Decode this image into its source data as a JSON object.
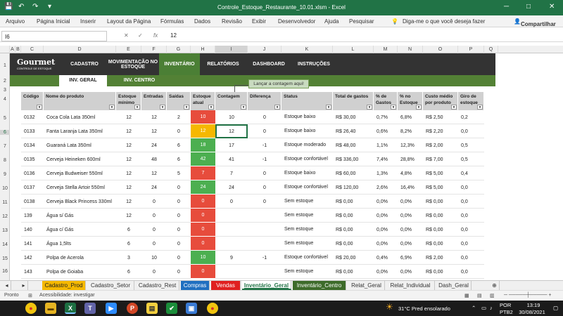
{
  "titlebar": {
    "title": "Controle_Estoque_Restaurante_10.01.xlsm  -  Excel"
  },
  "ribbon": {
    "tabs": [
      "Arquivo",
      "Página Inicial",
      "Inserir",
      "Layout da Página",
      "Fórmulas",
      "Dados",
      "Revisão",
      "Exibir",
      "Desenvolvedor",
      "Ajuda",
      "Pesquisar"
    ],
    "tell_me": "Diga-me o que você deseja fazer",
    "share": "Compartilhar"
  },
  "formula": {
    "name_box": "I6",
    "fx": "fx",
    "value": "12"
  },
  "columns": [
    "A",
    "B",
    "C",
    "D",
    "E",
    "F",
    "G",
    "H",
    "I",
    "J",
    "K",
    "L",
    "M",
    "N",
    "O",
    "P",
    "Q"
  ],
  "rows": [
    "1",
    "2",
    "3",
    "4",
    "5",
    "6",
    "7",
    "8",
    "9",
    "10",
    "11",
    "12",
    "13",
    "14",
    "15",
    "16"
  ],
  "nav": {
    "logo": "Gourmet",
    "logo_sub": "CONTROLE DE ESTOQUE",
    "items": [
      "CADASTRO",
      "MOVIMENTAÇÃO NO ESTOQUE",
      "INVENTÁRIO",
      "RELATÓRIOS",
      "DASHBOARD",
      "INSTRUÇÕES"
    ]
  },
  "subtabs": [
    "INV. GERAL",
    "INV. CENTRO"
  ],
  "callout": "Lançar a contagem aqui!",
  "table": {
    "headers": [
      "Código",
      "Nome do produto",
      "Estoque mínimo",
      "Entradas",
      "Saídas",
      "Estoque atual",
      "Contagem",
      "Diferença",
      "Status",
      "Total de gastos",
      "% de Gastos",
      "% no Estoque",
      "Custo médio por produto",
      "Giro de estoque"
    ],
    "rows": [
      [
        "0132",
        "Coca Cola Lata 350ml",
        "12",
        "12",
        "2",
        "10",
        "10",
        "0",
        "Estoque baixo",
        "R$ 30,00",
        "0,7%",
        "6,8%",
        "R$ 2,50",
        "0,2"
      ],
      [
        "0133",
        "Fanta Laranja Lata 350ml",
        "12",
        "12",
        "0",
        "12",
        "12",
        "0",
        "Estoque baixo",
        "R$ 26,40",
        "0,6%",
        "8,2%",
        "R$ 2,20",
        "0,0"
      ],
      [
        "0134",
        "Guaraná Lata 350ml",
        "12",
        "24",
        "6",
        "18",
        "17",
        "-1",
        "Estoque moderado",
        "R$ 48,00",
        "1,1%",
        "12,3%",
        "R$ 2,00",
        "0,5"
      ],
      [
        "0135",
        "Cerveja Heineken 600ml",
        "12",
        "48",
        "6",
        "42",
        "41",
        "-1",
        "Estoque confortável",
        "R$ 336,00",
        "7,4%",
        "28,8%",
        "R$ 7,00",
        "0,5"
      ],
      [
        "0136",
        "Cerveja Budweiser 550ml",
        "12",
        "12",
        "5",
        "7",
        "7",
        "0",
        "Estoque baixo",
        "R$ 60,00",
        "1,3%",
        "4,8%",
        "R$ 5,00",
        "0,4"
      ],
      [
        "0137",
        "Cerveja Stella Artoir 550ml",
        "12",
        "24",
        "0",
        "24",
        "24",
        "0",
        "Estoque confortável",
        "R$ 120,00",
        "2,6%",
        "16,4%",
        "R$ 5,00",
        "0,0"
      ],
      [
        "0138",
        "Cerveja Black Princess 330ml",
        "12",
        "0",
        "0",
        "0",
        "0",
        "0",
        "Sem estoque",
        "R$ 0,00",
        "0,0%",
        "0,0%",
        "R$ 0,00",
        "0,0"
      ],
      [
        "139",
        "Água s/ Gás",
        "12",
        "0",
        "0",
        "0",
        "",
        "",
        "Sem estoque",
        "R$ 0,00",
        "0,0%",
        "0,0%",
        "R$ 0,00",
        "0,0"
      ],
      [
        "140",
        "Água c/ Gás",
        "6",
        "0",
        "0",
        "0",
        "",
        "",
        "Sem estoque",
        "R$ 0,00",
        "0,0%",
        "0,0%",
        "R$ 0,00",
        "0,0"
      ],
      [
        "141",
        "Água 1,5lts",
        "6",
        "0",
        "0",
        "0",
        "",
        "",
        "Sem estoque",
        "R$ 0,00",
        "0,0%",
        "0,0%",
        "R$ 0,00",
        "0,0"
      ],
      [
        "142",
        "Polpa de Acerola",
        "3",
        "10",
        "0",
        "10",
        "9",
        "-1",
        "Estoque confortável",
        "R$ 20,00",
        "0,4%",
        "6,9%",
        "R$ 2,00",
        "0,0"
      ],
      [
        "143",
        "Polpa de Goiaba",
        "6",
        "0",
        "0",
        "0",
        "",
        "",
        "Sem estoque",
        "R$ 0,00",
        "0,0%",
        "0,0%",
        "R$ 0,00",
        "0,0"
      ]
    ],
    "atual_colors": [
      "red",
      "orange",
      "green",
      "green",
      "red",
      "green",
      "red",
      "red",
      "red",
      "red",
      "green",
      "red"
    ]
  },
  "colors": {
    "red": "#e74c3c",
    "orange": "#f5b800",
    "green": "#4caf50",
    "excel_green": "#217346"
  },
  "sheets": [
    {
      "name": "Cadastro_Prod",
      "bg": "#f5b800",
      "fg": "#222"
    },
    {
      "name": "Cadastro_Setor",
      "bg": "",
      "fg": "#333"
    },
    {
      "name": "Cadastro_Rest",
      "bg": "",
      "fg": "#333"
    },
    {
      "name": "Compras",
      "bg": "#1f6fc0",
      "fg": "#fff"
    },
    {
      "name": "Vendas",
      "bg": "#e02020",
      "fg": "#fff"
    },
    {
      "name": "Inventário_Geral",
      "bg": "#ffffff",
      "fg": "#217346"
    },
    {
      "name": "Inventário_Centro",
      "bg": "#3d6b2a",
      "fg": "#fff"
    },
    {
      "name": "Relat_Geral",
      "bg": "",
      "fg": "#333"
    },
    {
      "name": "Relat_Individual",
      "bg": "",
      "fg": "#333"
    },
    {
      "name": "Dash_Geral",
      "bg": "",
      "fg": "#333"
    }
  ],
  "status": {
    "ready": "Pronto",
    "accessibility": "Acessibilidade: investigar"
  },
  "taskbar": {
    "weather": "31°C  Pred ensolarado",
    "lang1": "POR",
    "lang2": "PTB2",
    "time": "13:19",
    "date": "30/08/2021"
  }
}
